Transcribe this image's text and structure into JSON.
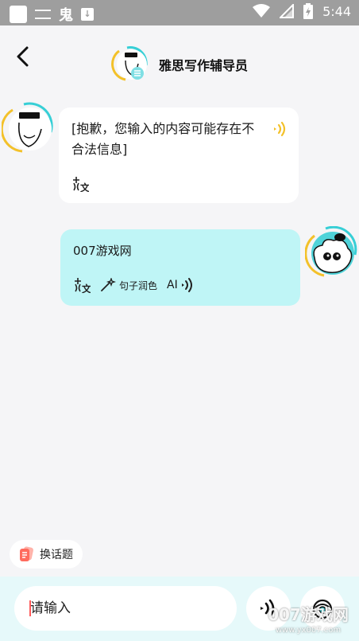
{
  "status_bar": {
    "time": "5:44",
    "notification_glyph": "鬼",
    "download_glyph": "↓"
  },
  "header": {
    "title": "雅思写作辅导员",
    "back_icon": "chevron-left-icon"
  },
  "messages": [
    {
      "role": "bot",
      "text": "[抱歉，您输入的内容可能存在不合法信息]",
      "actions": [
        {
          "icon": "translate-icon"
        }
      ],
      "speaker_color": "#f3c12a"
    },
    {
      "role": "user",
      "text": "007游戏网",
      "actions": [
        {
          "icon": "translate-icon"
        },
        {
          "icon": "magic-wand-icon",
          "label": "句子润色"
        },
        {
          "icon": "speaker-icon",
          "label": "AI"
        }
      ]
    }
  ],
  "topic_button": {
    "label": "换话题"
  },
  "composer": {
    "placeholder": "请输入"
  },
  "watermark": {
    "main": "007游戏网",
    "url": "www.yx007.com"
  },
  "colors": {
    "user_bubble": "#bff5f6",
    "bot_bubble": "#ffffff",
    "background": "#f5f5f7",
    "composer_bg": "#e6f9fa",
    "accent_gold": "#f3c12a",
    "accent_teal": "#37cfd6",
    "topic_icon": "#ff6b5e"
  }
}
